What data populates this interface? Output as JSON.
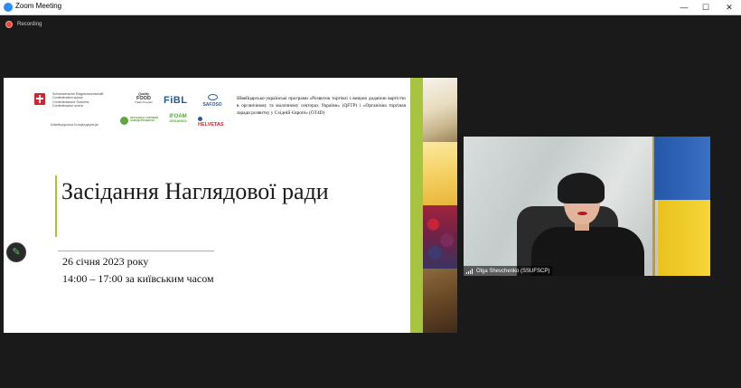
{
  "window": {
    "title": "Zoom Meeting",
    "controls": {
      "minimize": "—",
      "maximize": "☐",
      "close": "✕"
    }
  },
  "recording": {
    "label": "Recording",
    "icon": "record-dot-icon"
  },
  "slide": {
    "logos": {
      "swiss_names": [
        "Schweizerische Eidgenossenschaft",
        "Confédération suisse",
        "Confederazione Svizzera",
        "Confederaziun svizra"
      ],
      "swiss_ua": "Швейцарська Конфедерація",
      "quality_food": [
        "Quality",
        "FOOD",
        "Trade Program"
      ],
      "fibl": "FiBL",
      "safoso": "SAFOSO",
      "organic_ua": "ОРГАНІЧНА ТОРГІВЛЯ ЗАРАДИ РОЗВИТКУ",
      "ifoam": [
        "IFOAM",
        "ORGANICS"
      ],
      "helvetas": "HELVETAS"
    },
    "program_text": "Швейцарсько-українські програми «Розвиток торгівлі з вищою доданою вартістю в органічному та молочному секторах України» (QFTP) і «Органічна торгівля заради розвитку у Східній Європі» (OT4D)",
    "title": "Засідання Наглядової ради",
    "date": "26 січня 2023 року",
    "time": "14:00 – 17:00 за київським часом"
  },
  "participant": {
    "name": "Olga Shevchenko (SSUFSCP)",
    "signal_icon": "signal-bars-icon"
  },
  "annotate": {
    "icon": "pencil-icon",
    "glyph": "✎"
  },
  "colors": {
    "accent_green": "#a8c43f",
    "background": "#1a1a1a",
    "swiss_red": "#d8232a",
    "zoom_blue": "#2d8cff"
  }
}
